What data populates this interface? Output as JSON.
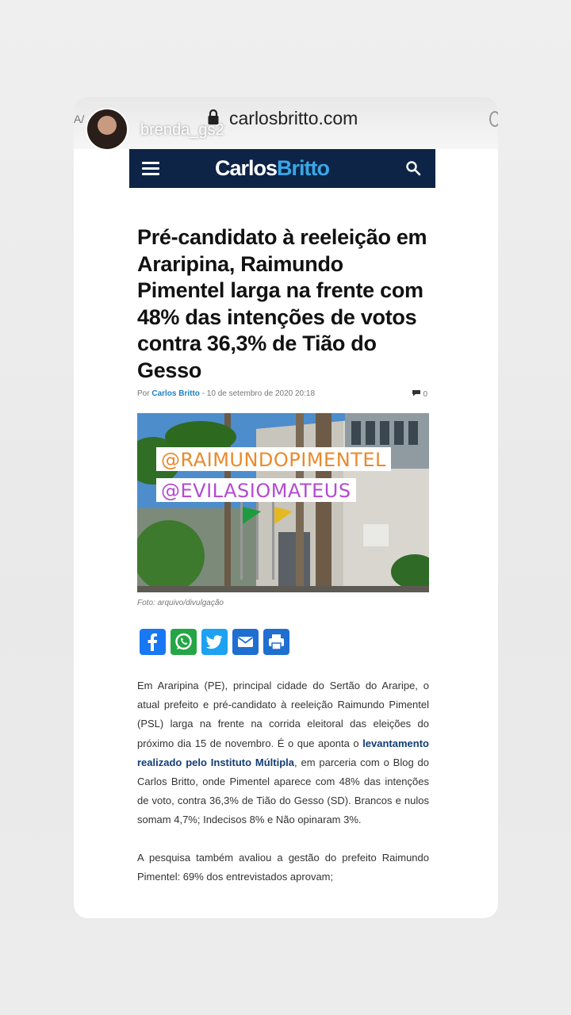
{
  "story": {
    "username": "brenda_gs2",
    "url": "carlosbritto.com"
  },
  "site": {
    "logo_part1": "Carlos",
    "logo_part2": "Britto"
  },
  "article": {
    "headline": "Pré-candidato à reeleição em Araripina, Raimundo Pimentel larga na frente com 48% das intenções de votos contra 36,3% de Tião do Gesso",
    "by_prefix": "Por",
    "author": "Carlos Britto",
    "separator": " - ",
    "date": "10 de setembro de 2020 20:18",
    "comments": "0",
    "photo_credit": "Foto: arquivo/divulgação",
    "tags": [
      "@RAIMUNDOPIMENTEL",
      "@EVILASIOMATEUS"
    ],
    "p1_a": "Em Araripina (PE), principal cidade do Sertão do Araripe, o atual prefeito e pré-candidato à reeleição Raimundo Pimentel (PSL) larga na frente na corrida eleitoral das eleições do próximo dia 15 de novembro. É o que aponta o ",
    "p1_link": "levantamento realizado pelo Instituto Múltipla",
    "p1_b": ", em parceria com o Blog do Carlos Britto, onde Pimentel aparece com 48% das intenções de voto, contra 36,3% de Tião do Gesso (SD). Brancos e nulos somam 4,7%; Indecisos 8% e Não opinaram 3%.",
    "p2": "A pesquisa também avaliou a gestão do prefeito Raimundo Pimentel: 69% dos entrevistados aprovam;"
  },
  "share": {
    "icons": [
      "facebook-icon",
      "whatsapp-icon",
      "twitter-icon",
      "email-icon",
      "print-icon"
    ],
    "colors": [
      "#1877f2",
      "#25a545",
      "#1da1f2",
      "#1f6fd1",
      "#1f6fd1"
    ]
  },
  "colors": {
    "header_bg": "#0d2447",
    "logo_accent": "#3aa6e6",
    "link": "#143d77"
  }
}
